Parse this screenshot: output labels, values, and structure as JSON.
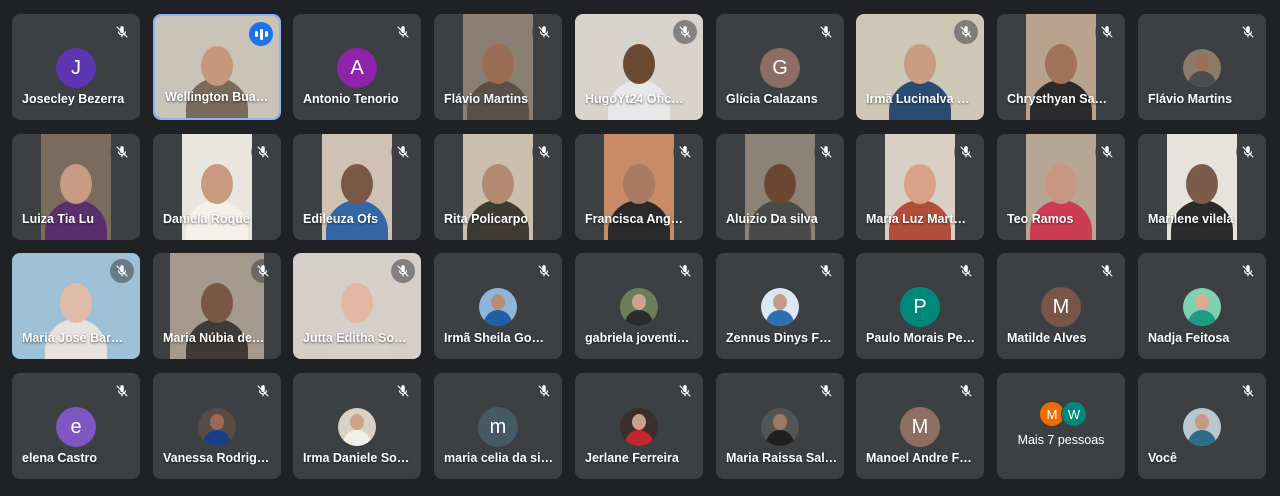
{
  "tiles": [
    {
      "name": "Josecley Bezerra",
      "type": "letter",
      "letter": "J",
      "color": "#5e35b1"
    },
    {
      "name": "Wellington Bua…",
      "type": "video",
      "speaking": true,
      "bg": "#c9c3b8",
      "skin": "#c6977c",
      "shirt": "#7a6a5c",
      "fw": 128
    },
    {
      "name": "Antonio Tenorio",
      "type": "letter",
      "letter": "A",
      "color": "#8e24aa"
    },
    {
      "name": "Flávio Martins",
      "type": "video",
      "bg": "#8a7f72",
      "skin": "#9a6e54",
      "shirt": "#5a5048",
      "fw": 70
    },
    {
      "name": "HugoYt24 Ofic…",
      "type": "video",
      "bg": "#d8d4cc",
      "skin": "#6b4a35",
      "shirt": "#e8e8e8",
      "fw": 128
    },
    {
      "name": "Glícia Calazans",
      "type": "letter",
      "letter": "G",
      "color": "#8d6e63"
    },
    {
      "name": "Irmã Lucinalva …",
      "type": "video",
      "bg": "#cfc7b5",
      "skin": "#c99d82",
      "shirt": "#2a4c73",
      "fw": 128
    },
    {
      "name": "Chrysthyan Sa…",
      "type": "video",
      "bg": "#b9a28e",
      "skin": "#a0735a",
      "shirt": "#2b2b2b",
      "fw": 70
    },
    {
      "name": "Flávio Martins",
      "type": "photo",
      "skin": "#9a6e54",
      "shirt": "#4d4d4d",
      "pbg": "#8a7a66"
    },
    {
      "name": "Luiza Tia Lu",
      "type": "video",
      "bg": "#7b6b5c",
      "skin": "#c79a86",
      "shirt": "#5a2f6e",
      "fw": 70
    },
    {
      "name": "Daniela Roque",
      "type": "video",
      "bg": "#e9e6e0",
      "skin": "#c99a7f",
      "shirt": "#f4f1ea",
      "fw": 70
    },
    {
      "name": "Edileuza Ofs",
      "type": "video",
      "bg": "#cfc2b3",
      "skin": "#7b5846",
      "shirt": "#3567a8",
      "fw": 70
    },
    {
      "name": "Rita Policarpo",
      "type": "video",
      "bg": "#cbbfae",
      "skin": "#b38a72",
      "shirt": "#3f3a32",
      "fw": 70
    },
    {
      "name": "Francisca Ang…",
      "type": "video",
      "bg": "#c98a67",
      "skin": "#aa7a61",
      "shirt": "#2a2a2a",
      "fw": 70
    },
    {
      "name": "Aluizio Da silva",
      "type": "video",
      "bg": "#8c8276",
      "skin": "#6b4733",
      "shirt": "#4a4a4a",
      "fw": 70
    },
    {
      "name": "Maria Luz Mart…",
      "type": "video",
      "bg": "#d8d0c4",
      "skin": "#d9a188",
      "shirt": "#b24e3b",
      "fw": 70
    },
    {
      "name": "Teo Ramos",
      "type": "video",
      "bg": "#b8a695",
      "skin": "#c89783",
      "shirt": "#cc3c52",
      "fw": 70
    },
    {
      "name": "Marilene vilela",
      "type": "video",
      "bg": "#e6e2dc",
      "skin": "#7d5b4b",
      "shirt": "#2b2b2b",
      "fw": 70
    },
    {
      "name": "Maria José Bar…",
      "type": "video",
      "bg": "#9ec1d8",
      "skin": "#e0bba9",
      "shirt": "#e7e2e0",
      "fw": 128
    },
    {
      "name": "Maria Núbia de…",
      "type": "video",
      "bg": "#a69a8f",
      "skin": "#7a5644",
      "shirt": "#3f3a36",
      "fw": 94
    },
    {
      "name": "Jutta Editha So…",
      "type": "video",
      "bg": "#d6cfc7",
      "skin": "#e2b7a4",
      "shirt": "#d6d0cb",
      "fw": 128
    },
    {
      "name": "Irmã Sheila Go…",
      "type": "photo",
      "skin": "#b68f73",
      "shirt": "#1e5fa8",
      "pbg": "#8fb6d8"
    },
    {
      "name": "gabriela joventi…",
      "type": "photo",
      "skin": "#cba48f",
      "shirt": "#2b2b2b",
      "pbg": "#6c7d5a"
    },
    {
      "name": "Zennus Dinys F…",
      "type": "photo",
      "skin": "#c39a85",
      "shirt": "#2d6fb1",
      "pbg": "#dbe7f2"
    },
    {
      "name": "Paulo Morais Pe…",
      "type": "letter",
      "letter": "P",
      "color": "#00897b"
    },
    {
      "name": "Matilde Alves",
      "type": "letter",
      "letter": "M",
      "color": "#795548"
    },
    {
      "name": "Nadja Feitosa",
      "type": "photo",
      "skin": "#d9ac93",
      "shirt": "#1e9c83",
      "pbg": "#7dd3b0"
    },
    {
      "name": "elena Castro",
      "type": "letter",
      "letter": "e",
      "color": "#7e57c2"
    },
    {
      "name": "Vanessa Rodrig…",
      "type": "photo",
      "skin": "#9a6a55",
      "shirt": "#1a3d8c",
      "pbg": "#5a4c44"
    },
    {
      "name": "Irma Daniele So…",
      "type": "photo",
      "skin": "#cda28a",
      "shirt": "#f1efe9",
      "pbg": "#d8d1c4"
    },
    {
      "name": "maria celia da si…",
      "type": "letter",
      "letter": "m",
      "color": "#455a64"
    },
    {
      "name": "Jerlane Ferreira",
      "type": "photo",
      "skin": "#caa08a",
      "shirt": "#c2262f",
      "pbg": "#3a2f2c"
    },
    {
      "name": "Maria Raissa Sal…",
      "type": "photo",
      "skin": "#9e7a64",
      "shirt": "#202020",
      "pbg": "#555"
    },
    {
      "name": "Manoel Andre F…",
      "type": "letter",
      "letter": "M",
      "color": "#8d6e63"
    },
    {
      "name": "Mais 7 pessoas",
      "type": "more",
      "avatars": [
        {
          "letter": "M",
          "color": "#ef6c00"
        },
        {
          "letter": "W",
          "color": "#00897b"
        }
      ]
    },
    {
      "name": "Você",
      "type": "photo",
      "skin": "#c69a82",
      "shirt": "#2d6d8c",
      "pbg": "#b9c8cf"
    }
  ]
}
